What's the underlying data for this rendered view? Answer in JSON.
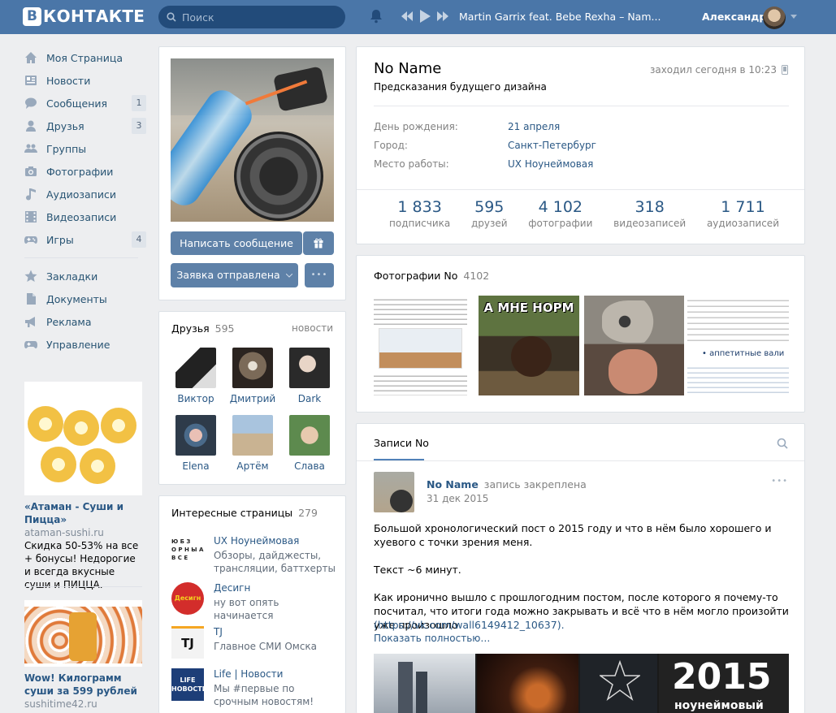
{
  "header": {
    "logo_letter": "В",
    "logo_text": "КОНТАКТЕ",
    "search_placeholder": "Поиск",
    "track": "Martin Garrix feat. Bebe Rexha – Nam...",
    "user_name": "Александр"
  },
  "nav": {
    "items": [
      {
        "label": "Моя Страница",
        "icon": "home-icon",
        "badge": ""
      },
      {
        "label": "Новости",
        "icon": "news-icon",
        "badge": ""
      },
      {
        "label": "Сообщения",
        "icon": "messages-icon",
        "badge": "1"
      },
      {
        "label": "Друзья",
        "icon": "friends-icon",
        "badge": "3"
      },
      {
        "label": "Группы",
        "icon": "groups-icon",
        "badge": ""
      },
      {
        "label": "Фотографии",
        "icon": "camera-icon",
        "badge": ""
      },
      {
        "label": "Аудиозаписи",
        "icon": "music-icon",
        "badge": ""
      },
      {
        "label": "Видеозаписи",
        "icon": "film-icon",
        "badge": ""
      },
      {
        "label": "Игры",
        "icon": "gamepad-icon",
        "badge": "4"
      }
    ],
    "items2": [
      {
        "label": "Закладки",
        "icon": "star-icon"
      },
      {
        "label": "Документы",
        "icon": "document-icon"
      },
      {
        "label": "Реклама",
        "icon": "megaphone-icon"
      },
      {
        "label": "Управление",
        "icon": "gamepad-icon"
      }
    ]
  },
  "ads": [
    {
      "title": "«Атаман - Суши и Пицца»",
      "domain": "ataman-sushi.ru",
      "desc": "Скидка 50-53% на все + бонусы! Недорогие и всегда вкусные суши и ПИЦЦА."
    },
    {
      "title": "Wow! Килограмм суши за 599 рублей",
      "domain": "sushitime42.ru"
    }
  ],
  "profile": {
    "send_message": "Написать сообщение",
    "request_sent": "Заявка отправлена",
    "more": "•••"
  },
  "friends": {
    "title": "Друзья",
    "count": "595",
    "news_link": "новости",
    "list": [
      "Виктор",
      "Дмитрий",
      "Dark",
      "Elena",
      "Артём",
      "Слава"
    ]
  },
  "interesting": {
    "title": "Интересные страницы",
    "count": "279",
    "list": [
      {
        "name": "UX Ноунеймовая",
        "desc": "Обзоры, дайджесты, трансляции, баттхерты",
        "logo_text": "Ю Б З\nО Р Н Ы А\nВ С Е"
      },
      {
        "name": "Десигн",
        "desc": "ну вот опять начинается",
        "logo_text": "Десигн"
      },
      {
        "name": "TJ",
        "desc": "Главное СМИ Омска",
        "logo_text": "TJ"
      },
      {
        "name": "Life | Новости",
        "desc": "Мы #первые по срочным новостям!",
        "logo_text": "LIFE\nНОВОСТИ"
      }
    ]
  },
  "info": {
    "name": "No Name",
    "status": "Предсказания будущего дизайна",
    "last_seen": "заходил сегодня в 10:23",
    "fields": [
      {
        "label": "День рождения:",
        "value": "21 апреля"
      },
      {
        "label": "Город:",
        "value": "Санкт-Петербург"
      },
      {
        "label": "Место работы:",
        "value": "UX Ноунеймовая"
      }
    ],
    "counters": [
      {
        "num": "1 833",
        "label": "подписчика"
      },
      {
        "num": "595",
        "label": "друзей"
      },
      {
        "num": "4 102",
        "label": "фотографии"
      },
      {
        "num": "318",
        "label": "видеозаписей"
      },
      {
        "num": "1 711",
        "label": "аудиозаписей"
      }
    ]
  },
  "photos": {
    "title": "Фотографии No",
    "count": "4102",
    "meme_text": "А МНЕ НОРМ",
    "doc_text": "• аппетитные вали"
  },
  "posts": {
    "tab": "Записи No",
    "author": "No Name",
    "action": "запись закреплена",
    "date": "31 дек 2015",
    "p1": "Большой хронологический пост о 2015 году и что в нём было хорошего и хуевого с точки зрения меня.",
    "p2": "Текст ~6 минут.",
    "p3": "Как иронично вышло с прошлогодним постом, после которого я почему-то посчитал, что итоги года можно закрывать и всё что в нём могло произойти уже произошло",
    "link": "(https://vk.com/wall6149412_10637).",
    "show_more": "Показать полностью…",
    "img_year": "2015",
    "img_sub": "ноунеймовый"
  }
}
